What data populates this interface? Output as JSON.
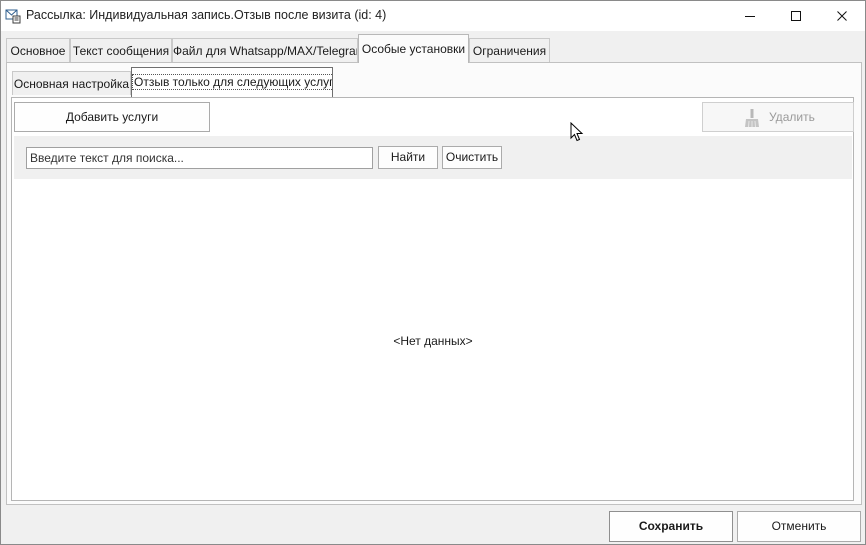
{
  "window": {
    "title": "Рассылка: Индивидуальная запись.Отзыв после визита (id: 4)",
    "app_icon": "mail-settings-icon"
  },
  "tabs": [
    {
      "label": "Основное",
      "active": false
    },
    {
      "label": "Текст сообщения",
      "active": false
    },
    {
      "label": "Файл для Whatsapp/MAX/Telegram",
      "active": false
    },
    {
      "label": "Особые установки",
      "active": true
    },
    {
      "label": "Ограничения",
      "active": false
    }
  ],
  "subtabs": [
    {
      "label": "Основная настройка",
      "active": false
    },
    {
      "label": "Отзыв только для следующих услуг",
      "active": true
    }
  ],
  "toolbar": {
    "add_label": "Добавить услуги",
    "delete_label": "Удалить",
    "delete_icon": "broom-icon"
  },
  "search": {
    "placeholder": "Введите текст для поиска...",
    "value": "",
    "find_label": "Найти",
    "clear_label": "Очистить"
  },
  "grid": {
    "empty_text": "<Нет данных>"
  },
  "footer": {
    "save_label": "Сохранить",
    "cancel_label": "Отменить"
  }
}
